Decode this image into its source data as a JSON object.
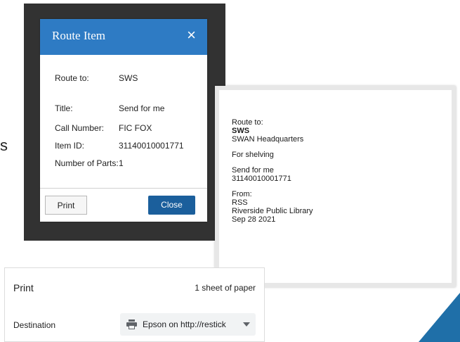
{
  "stray_text": "s",
  "dialog": {
    "title": "Route Item",
    "close_icon": "×",
    "rows": [
      {
        "label": "Route to:",
        "value": "SWS"
      },
      {
        "label": "Title:",
        "value": "Send for me"
      },
      {
        "label": "Call Number:",
        "value": "FIC FOX"
      },
      {
        "label": "Item ID:",
        "value": "31140010001771"
      },
      {
        "label": "Number of Parts:",
        "value": "1"
      }
    ],
    "print_label": "Print",
    "close_label": "Close"
  },
  "slip": {
    "route_label": "Route to:",
    "route_code": "SWS",
    "route_name": "SWAN Headquarters",
    "purpose": "For shelving",
    "title": "Send for me",
    "item_id": "31140010001771",
    "from_label": "From:",
    "from_code": "RSS",
    "from_name": "Riverside Public Library",
    "date": "Sep 28 2021"
  },
  "print_panel": {
    "title": "Print",
    "sheets": "1 sheet of paper",
    "destination_label": "Destination",
    "destination_value": "Epson on http://restick"
  },
  "colors": {
    "header_blue": "#2e7bc4",
    "close_button": "#1b5f9c",
    "frame": "#323232",
    "accent_triangle": "#1f6fa8"
  }
}
